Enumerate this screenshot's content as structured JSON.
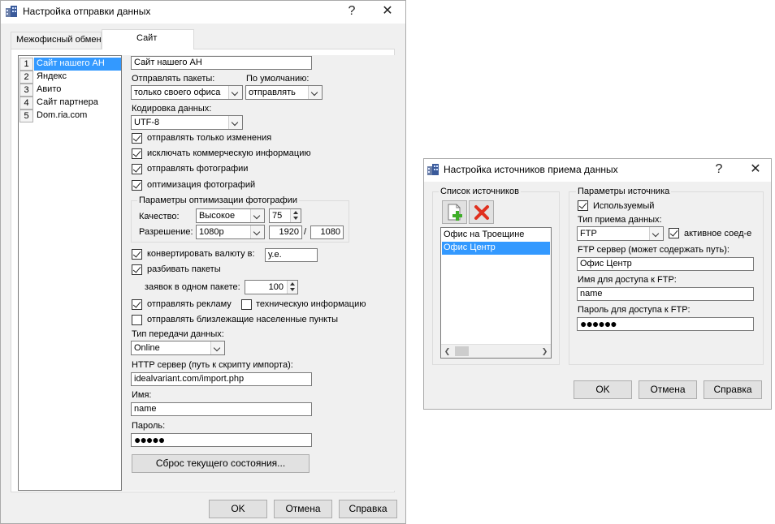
{
  "dialog1": {
    "title": "Настройка отправки данных",
    "help_glyph": "?",
    "close_glyph": "✕",
    "tabs": [
      {
        "label": "Межофисный обмен"
      },
      {
        "label": "Сайт"
      }
    ],
    "sites": [
      {
        "num": "1",
        "name": "Сайт нашего АН"
      },
      {
        "num": "2",
        "name": "Яндекс"
      },
      {
        "num": "3",
        "name": "Авито"
      },
      {
        "num": "4",
        "name": "Сайт партнера"
      },
      {
        "num": "5",
        "name": "Dom.ria.com"
      }
    ],
    "site_name_value": "Сайт нашего АН",
    "send_packets_label": "Отправлять пакеты:",
    "send_packets_value": "только своего офиса",
    "default_label": "По умолчанию:",
    "default_value": "отправлять",
    "encoding_label": "Кодировка данных:",
    "encoding_value": "UTF-8",
    "cb_changes_only": "отправлять только изменения",
    "cb_exclude_commercial": "исключать коммерческую информацию",
    "cb_send_photos": "отправлять фотографии",
    "cb_optimize_photos": "оптимизация фотографий",
    "photo_group_title": "Параметры оптимизации фотографии",
    "quality_label": "Качество:",
    "quality_value": "Высокое",
    "quality_number": "75",
    "resolution_label": "Разрешение:",
    "resolution_value": "1080p",
    "res_width": "1920",
    "res_sep": "/",
    "res_height": "1080",
    "cb_convert_currency": "конвертировать валюту в:",
    "currency_value": "у.е.",
    "cb_split_packets": "разбивать пакеты",
    "requests_per_packet_label": "заявок в одном пакете:",
    "requests_per_packet_value": "100",
    "cb_send_ads": "отправлять рекламу",
    "cb_tech_info": "техническую информацию",
    "cb_nearby": "отправлять близлежащие населенные пункты",
    "transfer_type_label": "Тип передачи данных:",
    "transfer_type_value": "Online",
    "http_server_label": "HTTP сервер (путь к скрипту импорта):",
    "http_server_value": "idealvariant.com/import.php",
    "name_label": "Имя:",
    "name_value": "name",
    "password_label": "Пароль:",
    "password_value": "●●●●●",
    "reset_button": "Сброс текущего состояния...",
    "ok_button": "OK",
    "cancel_button": "Отмена",
    "help_button": "Справка"
  },
  "dialog2": {
    "title": "Настройка источников приема данных",
    "help_glyph": "?",
    "close_glyph": "✕",
    "sources_group_title": "Список источников",
    "sources": [
      {
        "name": "Офис на Троещине"
      },
      {
        "name": "Офис Центр"
      }
    ],
    "params_group_title": "Параметры источника",
    "cb_used": "Используемый",
    "receive_type_label": "Тип приема данных:",
    "receive_type_value": "FTP",
    "cb_active_conn": "активное соед-е",
    "ftp_server_label": "FTP сервер (может содержать путь):",
    "ftp_server_value": "Офис Центр",
    "ftp_user_label": "Имя для доступа к FTP:",
    "ftp_user_value": "name",
    "ftp_password_label": "Пароль для доступа к FTP:",
    "ftp_password_value": "●●●●●●",
    "ok_button": "OK",
    "cancel_button": "Отмена",
    "help_button": "Справка"
  },
  "colors": {
    "selection": "#3399ff",
    "dialog_bg": "#f0f0f0",
    "add_icon_green": "#3fae29",
    "delete_icon_red": "#e0301e"
  }
}
